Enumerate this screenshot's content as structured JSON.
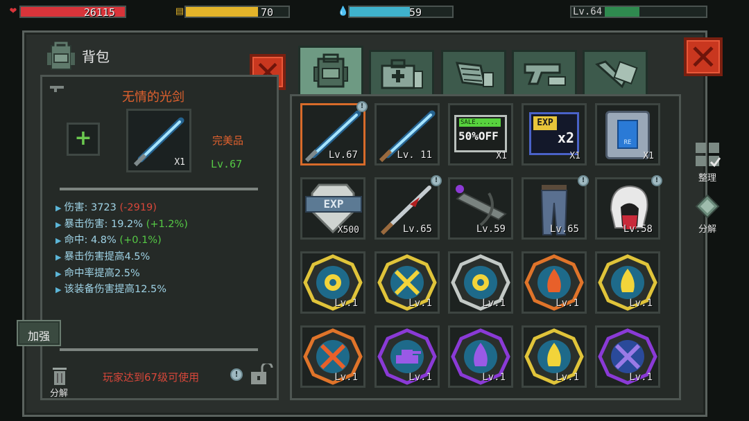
{
  "hud": {
    "hp": "26115",
    "energy": "70",
    "water": "59",
    "level": "Lv.64"
  },
  "bag": {
    "title": "背包",
    "item_name": "无情的光剑",
    "quality": "完美品",
    "item_level": "Lv.67",
    "item_qty": "X1",
    "add_symbol": "+",
    "stats": [
      {
        "label": "伤害: ",
        "value": "3723",
        "delta": "(-2919)",
        "delta_type": "neg"
      },
      {
        "label": "暴击伤害: ",
        "value": "19.2%",
        "delta": "(+1.2%)",
        "delta_type": "pos"
      },
      {
        "label": "命中: ",
        "value": "4.8%",
        "delta": "(+0.1%)",
        "delta_type": "pos"
      },
      {
        "label": "暴击伤害提高4.5%",
        "value": "",
        "delta": "",
        "delta_type": ""
      },
      {
        "label": "命中率提高2.5%",
        "value": "",
        "delta": "",
        "delta_type": ""
      },
      {
        "label": "该装备伤害提高12.5%",
        "value": "",
        "delta": "",
        "delta_type": ""
      }
    ],
    "enhance_label": "加强",
    "requirement": "玩家达到67级可使用",
    "decompose_label": "分解",
    "info_symbol": "!"
  },
  "side": {
    "sort_label": "整理",
    "decompose_label": "分解"
  },
  "grid": {
    "row1": [
      {
        "text": "Lv.67"
      },
      {
        "text": "Lv. 11"
      },
      {
        "text": "X1",
        "banner": "SALE......",
        "big": "50%OFF"
      },
      {
        "text": "X1",
        "banner": "EXP",
        "big": "x2"
      },
      {
        "text": "X1",
        "banner": "RE"
      }
    ],
    "row2": [
      {
        "text": "X500",
        "banner": "EXP"
      },
      {
        "text": "Lv.65"
      },
      {
        "text": "Lv.59"
      },
      {
        "text": "Lv.65"
      },
      {
        "text": "Lv.58"
      }
    ],
    "row3": [
      "Lv.1",
      "Lv.1",
      "Lv.1",
      "Lv.1",
      "Lv.1"
    ],
    "row4": [
      "Lv.1",
      "Lv.1",
      "Lv.1",
      "Lv.1",
      "Lv.1"
    ]
  },
  "colors": {
    "hp": "#d8343a",
    "energy": "#e3b42a",
    "water": "#3fb2cc",
    "xp": "#2f8a4f",
    "accent_orange": "#e0612e",
    "close_red": "#c9371f"
  }
}
